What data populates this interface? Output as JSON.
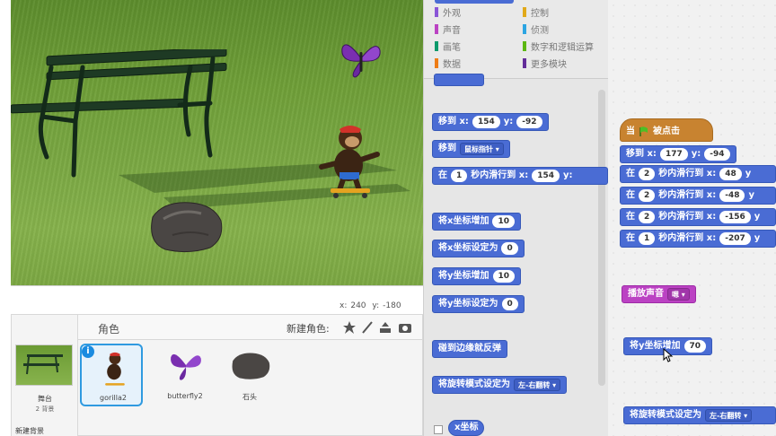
{
  "categories": {
    "left": [
      {
        "label": "外观",
        "color": "#8a55d7"
      },
      {
        "label": "声音",
        "color": "#bb42c3"
      },
      {
        "label": "画笔",
        "color": "#0e9a6c"
      },
      {
        "label": "数据",
        "color": "#ee7d16"
      }
    ],
    "right": [
      {
        "label": "控制",
        "color": "#e1a91a"
      },
      {
        "label": "侦测",
        "color": "#2ca5e2"
      },
      {
        "label": "数字和逻辑运算",
        "color": "#5cb712"
      },
      {
        "label": "更多模块",
        "color": "#632d99"
      }
    ]
  },
  "palette": {
    "goto_xy": {
      "label": "移到 x:",
      "x": "154",
      "y_label": "y:",
      "y": "-92"
    },
    "goto_target": {
      "label": "移到",
      "target": "鼠标指针"
    },
    "glide": {
      "label_in": "在",
      "secs": "1",
      "label_mid": "秒内滑行到 x:",
      "x": "154",
      "y_label": "y:"
    },
    "change_x": {
      "label": "将x坐标增加",
      "value": "10"
    },
    "set_x": {
      "label": "将x坐标设定为",
      "value": "0"
    },
    "change_y": {
      "label": "将y坐标增加",
      "value": "10"
    },
    "set_y": {
      "label": "将y坐标设定为",
      "value": "0"
    },
    "bounce": {
      "label": "碰到边缘就反弹"
    },
    "rotation": {
      "label": "将旋转模式设定为",
      "value": "左-右翻转"
    },
    "x_reporter": {
      "label": "x坐标"
    }
  },
  "script": {
    "hat": {
      "label_when": "当",
      "label_clicked": "被点击"
    },
    "goto": {
      "label": "移到 x:",
      "x": "177",
      "y_label": "y:",
      "y": "-94"
    },
    "glides": [
      {
        "label_in": "在",
        "secs": "2",
        "label_mid": "秒内滑行到 x:",
        "x": "48",
        "y_label": "y"
      },
      {
        "label_in": "在",
        "secs": "2",
        "label_mid": "秒内滑行到 x:",
        "x": "-48",
        "y_label": "y"
      },
      {
        "label_in": "在",
        "secs": "2",
        "label_mid": "秒内滑行到 x:",
        "x": "-156",
        "y_label": "y"
      },
      {
        "label_in": "在",
        "secs": "1",
        "label_mid": "秒内滑行到 x:",
        "x": "-207",
        "y_label": "y"
      }
    ],
    "sound": {
      "label": "播放声音",
      "value": "嗯"
    },
    "change_y": {
      "label": "将y坐标增加",
      "value": "70"
    },
    "rotation": {
      "label": "将旋转模式设定为",
      "value": "左-右翻转"
    }
  },
  "stage": {
    "x_label": "x:",
    "x_value": "240",
    "y_label": "y:",
    "y_value": "-180"
  },
  "sprites": {
    "title": "角色",
    "new_sprite_label": "新建角色:",
    "stage_label": "舞台",
    "stage_sub": "2 背景",
    "new_backdrop": "新建背景",
    "items": [
      {
        "name": "gorilla2",
        "selected": true
      },
      {
        "name": "butterfly2",
        "selected": false
      },
      {
        "name": "石头",
        "selected": false
      }
    ]
  }
}
